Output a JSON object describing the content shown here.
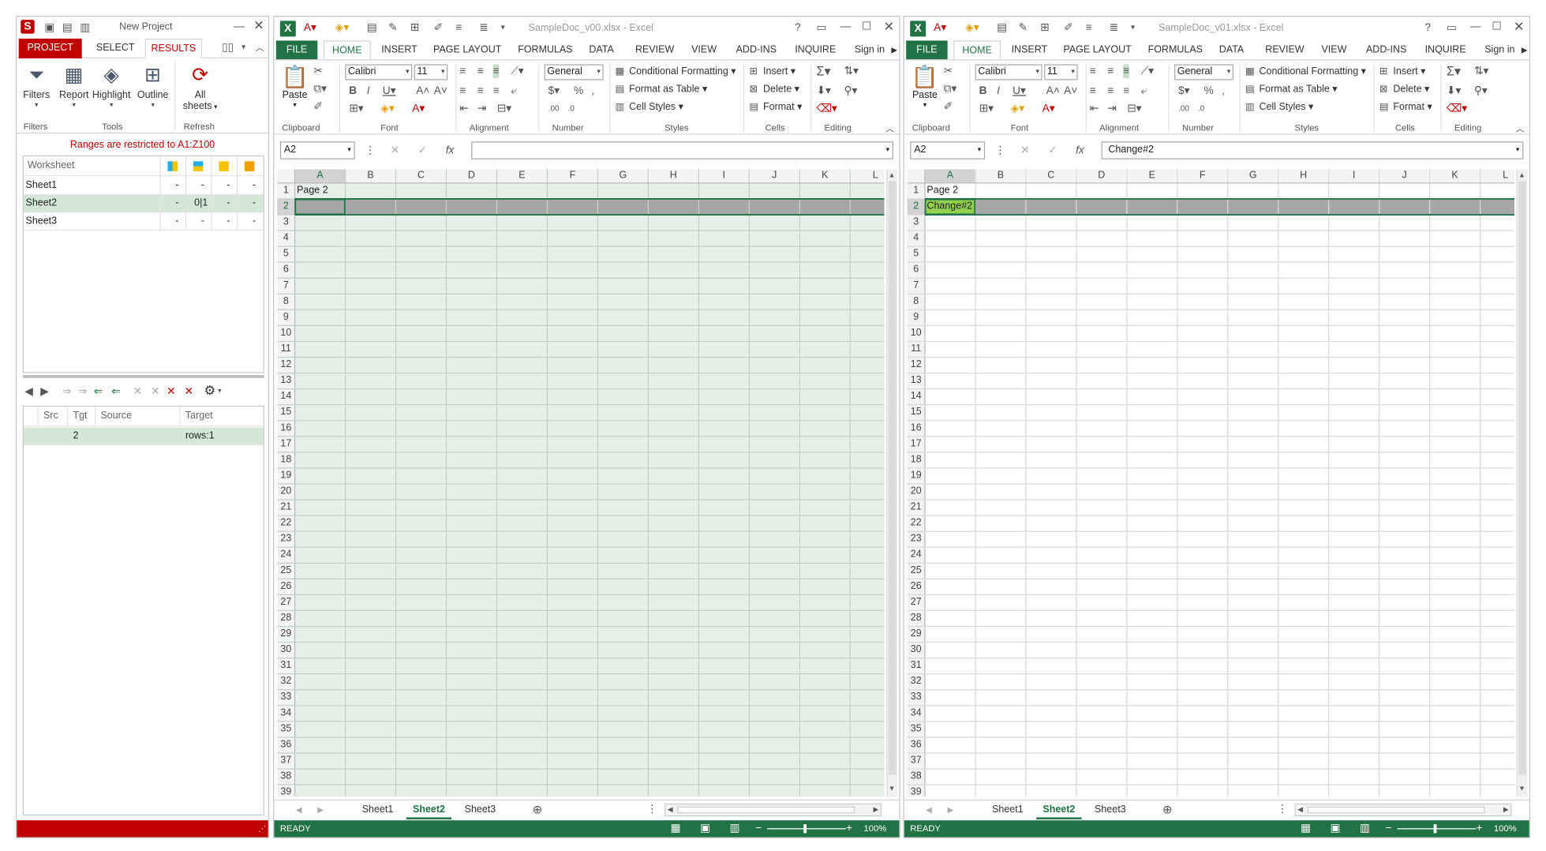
{
  "sync": {
    "title": "New Project",
    "tabs": [
      "PROJECT",
      "SELECT",
      "RESULTS"
    ],
    "ribbon": {
      "buttons": [
        "Filters",
        "Report",
        "Highlight",
        "Outline",
        "All",
        "sheets"
      ],
      "groups": [
        "Filters",
        "Tools",
        "Refresh"
      ]
    },
    "restriction": "Ranges are restricted to A1:Z100",
    "worksheet_header": "Worksheet",
    "sheets": [
      {
        "name": "Sheet1",
        "c1": "-",
        "c2": "-",
        "c3": "-",
        "c4": "-"
      },
      {
        "name": "Sheet2",
        "c1": "-",
        "c2": "0|1",
        "c3": "-",
        "c4": "-"
      },
      {
        "name": "Sheet3",
        "c1": "-",
        "c2": "-",
        "c3": "-",
        "c4": "-"
      }
    ],
    "result_columns": [
      "Src",
      "Tgt",
      "Source",
      "Target"
    ],
    "result_row": {
      "src": "",
      "tgt": "2",
      "source": "",
      "target": "rows:1"
    }
  },
  "excel_left": {
    "title": "SampleDoc_v00.xlsx - Excel",
    "cell_ref": "A2",
    "formula": "",
    "a1": "Page 2",
    "a2": ""
  },
  "excel_right": {
    "title": "SampleDoc_v01.xlsx - Excel",
    "cell_ref": "A2",
    "formula": "Change#2",
    "a1": "Page 2",
    "a2": "Change#2"
  },
  "excel": {
    "tabs": [
      "FILE",
      "HOME",
      "INSERT",
      "PAGE LAYOUT",
      "FORMULAS",
      "DATA",
      "REVIEW",
      "VIEW",
      "ADD-INS",
      "INQUIRE"
    ],
    "sign_in": "Sign in",
    "paste": "Paste",
    "font_name": "Calibri",
    "font_size": "11",
    "number_format": "General",
    "styles": [
      "Conditional Formatting",
      "Format as Table",
      "Cell Styles"
    ],
    "cells": [
      "Insert",
      "Delete",
      "Format"
    ],
    "groups": [
      "Clipboard",
      "Font",
      "Alignment",
      "Number",
      "Styles",
      "Cells",
      "Editing"
    ],
    "sheet_tabs": [
      "Sheet1",
      "Sheet2",
      "Sheet3"
    ],
    "status": "READY",
    "zoom": "100%",
    "columns": [
      "A",
      "B",
      "C",
      "D",
      "E",
      "F",
      "G",
      "H",
      "I",
      "J",
      "K",
      "L"
    ],
    "rows": [
      "1",
      "2",
      "3",
      "4",
      "5",
      "6",
      "7",
      "8",
      "9",
      "10",
      "11",
      "12",
      "13",
      "14",
      "15",
      "16",
      "17",
      "18",
      "19",
      "20",
      "21",
      "22",
      "23",
      "24",
      "25",
      "26",
      "27",
      "28",
      "29",
      "30",
      "31",
      "32",
      "33",
      "34",
      "35",
      "36",
      "37",
      "38",
      "39"
    ]
  },
  "colors": {
    "excel_green": "#217346",
    "sync_red": "#c00000",
    "diff_fill": "#e6efe8",
    "changed_cell": "#92d050",
    "row_highlight": "#a6a6a6"
  }
}
